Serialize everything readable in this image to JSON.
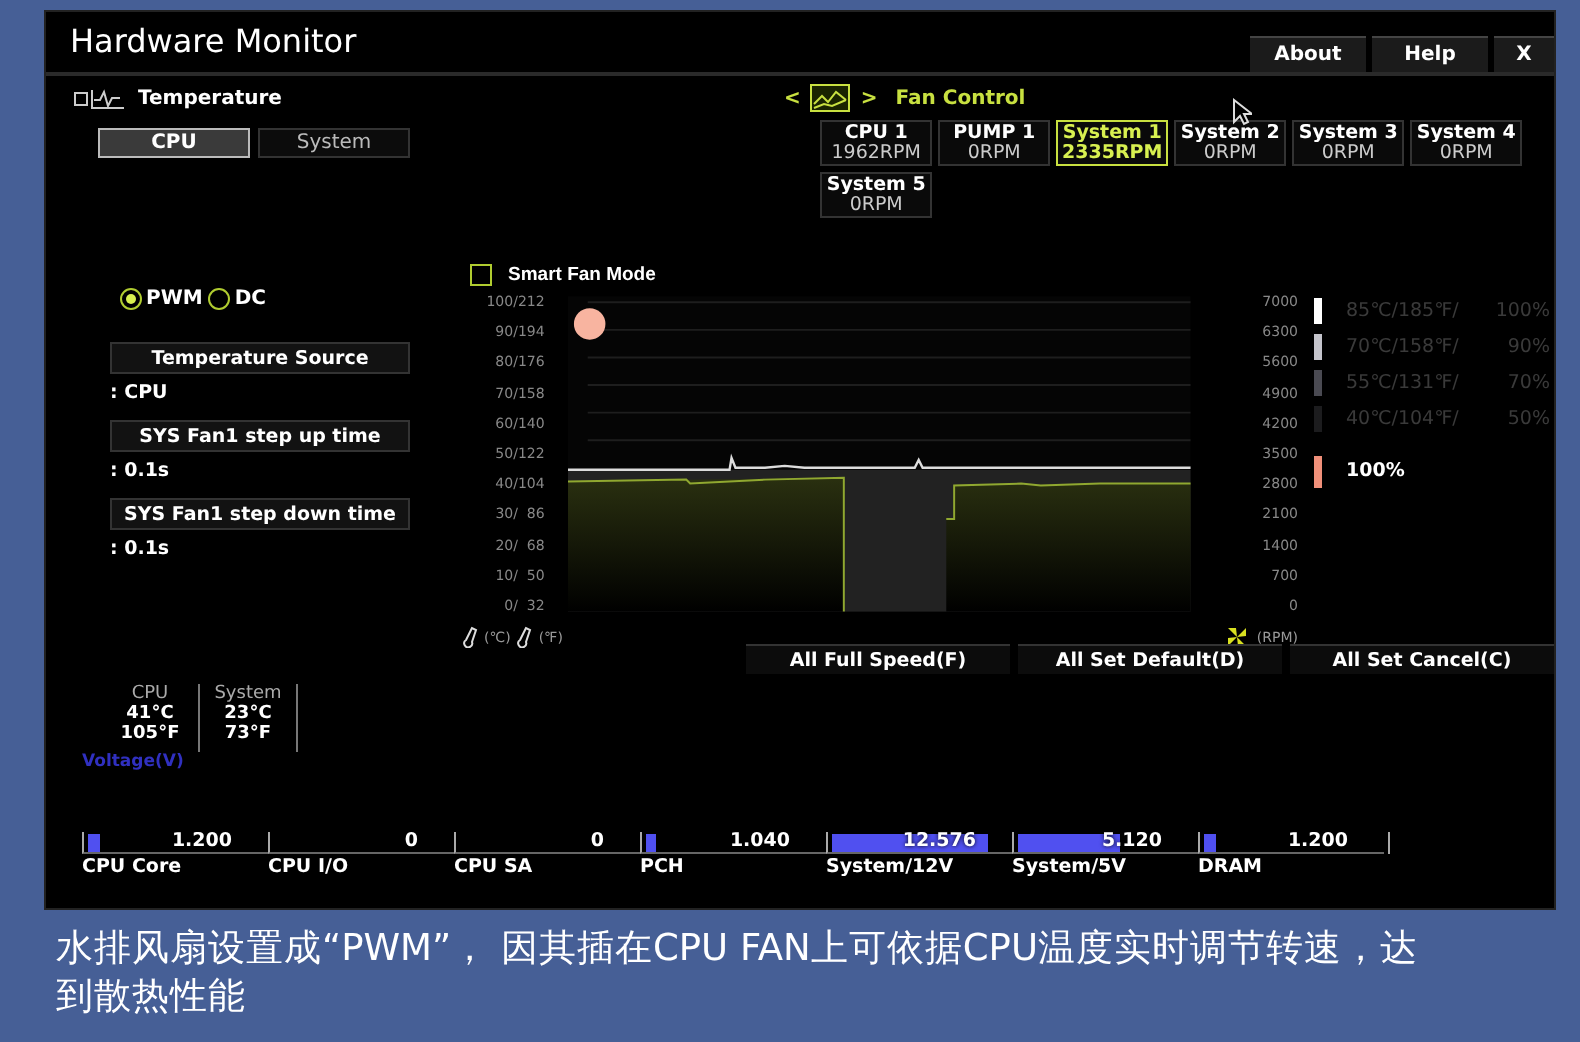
{
  "window": {
    "title": "Hardware Monitor",
    "buttons": [
      "About",
      "Help",
      "X"
    ]
  },
  "temperature": {
    "title": "Temperature",
    "tabs": [
      {
        "label": "CPU",
        "selected": true
      },
      {
        "label": "System",
        "selected": false
      }
    ]
  },
  "fan_control": {
    "prev": "<",
    "next": ">",
    "title": "Fan Control",
    "fans": [
      {
        "name": "CPU 1",
        "rpm": "1962RPM",
        "selected": false
      },
      {
        "name": "PUMP 1",
        "rpm": "0RPM",
        "selected": false
      },
      {
        "name": "System 1",
        "rpm": "2335RPM",
        "selected": true
      },
      {
        "name": "System 2",
        "rpm": "0RPM",
        "selected": false
      },
      {
        "name": "System 3",
        "rpm": "0RPM",
        "selected": false
      },
      {
        "name": "System 4",
        "rpm": "0RPM",
        "selected": false
      },
      {
        "name": "System 5",
        "rpm": "0RPM",
        "selected": false
      }
    ]
  },
  "fan_settings": {
    "modes": [
      {
        "label": "PWM",
        "selected": true
      },
      {
        "label": "DC",
        "selected": false
      }
    ],
    "settings": [
      {
        "label": "Temperature Source",
        "value": ": CPU"
      },
      {
        "label": "SYS Fan1 step up time",
        "value": ": 0.1s"
      },
      {
        "label": "SYS Fan1 step down time",
        "value": ": 0.1s"
      }
    ]
  },
  "graph": {
    "smart_fan_mode": {
      "label": "Smart Fan Mode",
      "checked": false
    },
    "left_ticks": [
      "100/212",
      "90/194",
      "80/176",
      "70/158",
      "60/140",
      "50/122",
      "40/104",
      "30/  86",
      "20/  68",
      "10/  50",
      "0/  32"
    ],
    "right_ticks": [
      "7000",
      "6300",
      "5600",
      "4900",
      "4200",
      "3500",
      "2800",
      "2100",
      "1400",
      "700",
      "0"
    ],
    "left_units": [
      "(℃)",
      "(℉)"
    ],
    "right_unit": "(RPM)"
  },
  "curve_points": [
    {
      "temp": "85℃/185℉/",
      "percent": "100%",
      "color": "#ffffff"
    },
    {
      "temp": "70℃/158℉/",
      "percent": "90%",
      "color": "#c4c4cc"
    },
    {
      "temp": "55℃/131℉/",
      "percent": "70%",
      "color": "#4a4a52"
    },
    {
      "temp": "40℃/104℉/",
      "percent": "50%",
      "color": "#1c1c1e"
    }
  ],
  "current": {
    "percent": "100%",
    "color": "#f0907a"
  },
  "actions": [
    "All Full Speed(F)",
    "All Set Default(D)",
    "All Set Cancel(C)"
  ],
  "readings": [
    {
      "name": "CPU",
      "celsius": "41°C",
      "fahrenheit": "105°F"
    },
    {
      "name": "System",
      "celsius": "23°C",
      "fahrenheit": "73°F"
    }
  ],
  "voltage": {
    "title": "Voltage(V)",
    "rails": [
      {
        "name": "CPU Core",
        "value": "1.200",
        "level": 0.07
      },
      {
        "name": "CPU I/O",
        "value": "0",
        "level": 0
      },
      {
        "name": "CPU SA",
        "value": "0",
        "level": 0
      },
      {
        "name": "PCH",
        "value": "1.040",
        "level": 0.06
      },
      {
        "name": "System/12V",
        "value": "12.576",
        "level": 0.92
      },
      {
        "name": "System/5V",
        "value": "5.120",
        "level": 0.6
      },
      {
        "name": "DRAM",
        "value": "1.200",
        "level": 0.07
      }
    ]
  },
  "caption": "水排风扇设置成“PWM”， 因其插在CPU FAN上可依据CPU温度实时调节转速，达到散热性能"
}
